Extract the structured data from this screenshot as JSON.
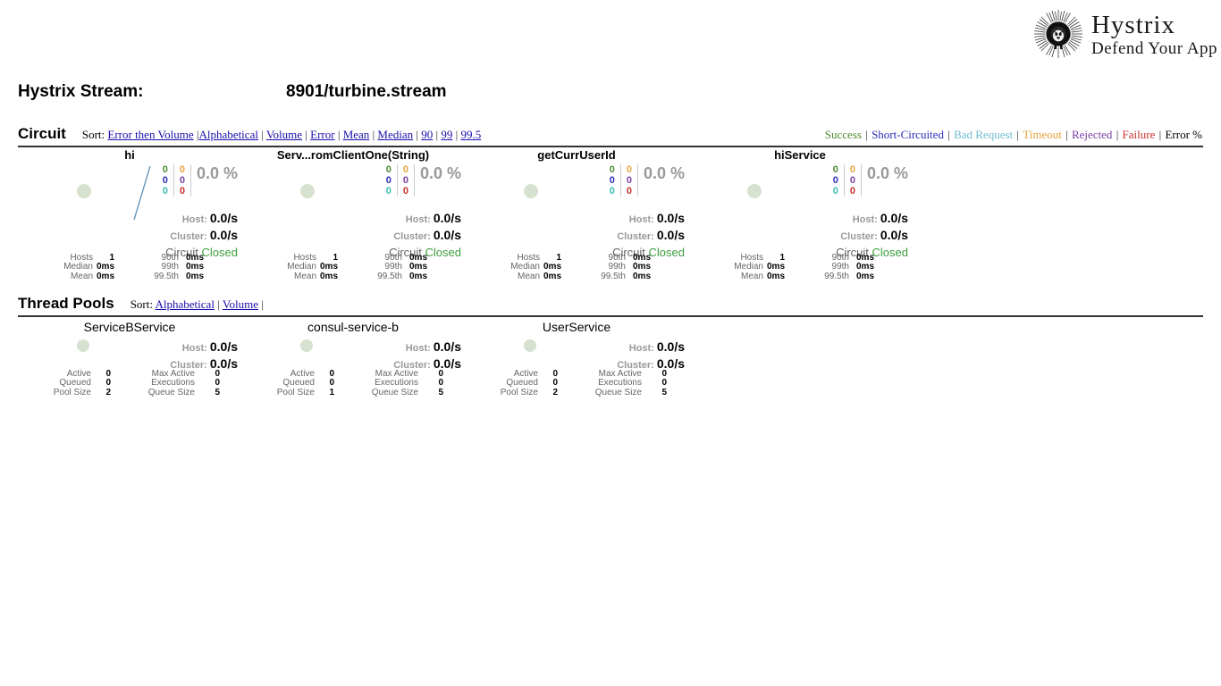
{
  "logo": {
    "title": "Hystrix",
    "subtitle": "Defend Your App",
    "mark_name": "hystrix-porcupine-logo"
  },
  "stream": {
    "label": "Hystrix Stream:",
    "value": "8901/turbine.stream"
  },
  "circuit_section": {
    "title": "Circuit",
    "sort_word": "Sort:",
    "sort_links": [
      "Error then Volume",
      "Alphabetical",
      "Volume",
      "Error",
      "Mean",
      "Median",
      "90",
      "99",
      "99.5"
    ],
    "legend": [
      {
        "label": "Success",
        "color": "#4d8b31"
      },
      {
        "label": "Short-Circuited",
        "color": "#2c2cb8"
      },
      {
        "label": "Bad Request",
        "color": "#6fbdd1"
      },
      {
        "label": "Timeout",
        "color": "#e8a33d"
      },
      {
        "label": "Rejected",
        "color": "#7a3ea3"
      },
      {
        "label": "Failure",
        "color": "#c9302c"
      },
      {
        "label": "Error %",
        "color": "#000000"
      }
    ]
  },
  "circuits": [
    {
      "name": "hi",
      "counters_left": [
        "0",
        "0",
        "0"
      ],
      "counters_right": [
        "0",
        "0",
        "0"
      ],
      "error_pct": "0.0 %",
      "host_label": "Host:",
      "host_rate": "0.0/s",
      "cluster_label": "Cluster:",
      "cluster_rate": "0.0/s",
      "circuit_label": "Circuit",
      "circuit_state": "Closed",
      "stats": [
        {
          "label": "Hosts",
          "value": "1",
          "label2": "90th",
          "value2": "0ms"
        },
        {
          "label": "Median",
          "value": "0ms",
          "label2": "99th",
          "value2": "0ms"
        },
        {
          "label": "Mean",
          "value": "0ms",
          "label2": "99.5th",
          "value2": "0ms"
        }
      ],
      "has_sparkline": true
    },
    {
      "name": "Serv...romClientOne(String)",
      "counters_left": [
        "0",
        "0",
        "0"
      ],
      "counters_right": [
        "0",
        "0",
        "0"
      ],
      "error_pct": "0.0 %",
      "host_label": "Host:",
      "host_rate": "0.0/s",
      "cluster_label": "Cluster:",
      "cluster_rate": "0.0/s",
      "circuit_label": "Circuit",
      "circuit_state": "Closed",
      "stats": [
        {
          "label": "Hosts",
          "value": "1",
          "label2": "90th",
          "value2": "0ms"
        },
        {
          "label": "Median",
          "value": "0ms",
          "label2": "99th",
          "value2": "0ms"
        },
        {
          "label": "Mean",
          "value": "0ms",
          "label2": "99.5th",
          "value2": "0ms"
        }
      ],
      "has_sparkline": false
    },
    {
      "name": "getCurrUserId",
      "counters_left": [
        "0",
        "0",
        "0"
      ],
      "counters_right": [
        "0",
        "0",
        "0"
      ],
      "error_pct": "0.0 %",
      "host_label": "Host:",
      "host_rate": "0.0/s",
      "cluster_label": "Cluster:",
      "cluster_rate": "0.0/s",
      "circuit_label": "Circuit",
      "circuit_state": "Closed",
      "stats": [
        {
          "label": "Hosts",
          "value": "1",
          "label2": "90th",
          "value2": "0ms"
        },
        {
          "label": "Median",
          "value": "0ms",
          "label2": "99th",
          "value2": "0ms"
        },
        {
          "label": "Mean",
          "value": "0ms",
          "label2": "99.5th",
          "value2": "0ms"
        }
      ],
      "has_sparkline": false
    },
    {
      "name": "hiService",
      "counters_left": [
        "0",
        "0",
        "0"
      ],
      "counters_right": [
        "0",
        "0",
        "0"
      ],
      "error_pct": "0.0 %",
      "host_label": "Host:",
      "host_rate": "0.0/s",
      "cluster_label": "Cluster:",
      "cluster_rate": "0.0/s",
      "circuit_label": "Circuit",
      "circuit_state": "Closed",
      "stats": [
        {
          "label": "Hosts",
          "value": "1",
          "label2": "90th",
          "value2": "0ms"
        },
        {
          "label": "Median",
          "value": "0ms",
          "label2": "99th",
          "value2": "0ms"
        },
        {
          "label": "Mean",
          "value": "0ms",
          "label2": "99.5th",
          "value2": "0ms"
        }
      ],
      "has_sparkline": false
    }
  ],
  "threadpool_section": {
    "title": "Thread Pools",
    "sort_word": "Sort:",
    "sort_links": [
      "Alphabetical",
      "Volume"
    ]
  },
  "threadpools": [
    {
      "name": "ServiceBService",
      "host_label": "Host:",
      "host_rate": "0.0/s",
      "cluster_label": "Cluster:",
      "cluster_rate": "0.0/s",
      "stats": [
        {
          "label": "Active",
          "value": "0",
          "label2": "Max Active",
          "value2": "0"
        },
        {
          "label": "Queued",
          "value": "0",
          "label2": "Executions",
          "value2": "0"
        },
        {
          "label": "Pool Size",
          "value": "2",
          "label2": "Queue Size",
          "value2": "5"
        }
      ]
    },
    {
      "name": "consul-service-b",
      "host_label": "Host:",
      "host_rate": "0.0/s",
      "cluster_label": "Cluster:",
      "cluster_rate": "0.0/s",
      "stats": [
        {
          "label": "Active",
          "value": "0",
          "label2": "Max Active",
          "value2": "0"
        },
        {
          "label": "Queued",
          "value": "0",
          "label2": "Executions",
          "value2": "0"
        },
        {
          "label": "Pool Size",
          "value": "1",
          "label2": "Queue Size",
          "value2": "5"
        }
      ]
    },
    {
      "name": "UserService",
      "host_label": "Host:",
      "host_rate": "0.0/s",
      "cluster_label": "Cluster:",
      "cluster_rate": "0.0/s",
      "stats": [
        {
          "label": "Active",
          "value": "0",
          "label2": "Max Active",
          "value2": "0"
        },
        {
          "label": "Queued",
          "value": "0",
          "label2": "Executions",
          "value2": "0"
        },
        {
          "label": "Pool Size",
          "value": "2",
          "label2": "Queue Size",
          "value2": "5"
        }
      ]
    }
  ],
  "colors": {
    "success": "#4d8b31",
    "short_circuited": "#2c2cb8",
    "bad_request": "#3fb9b0",
    "timeout": "#e8a33d",
    "rejected": "#7a3ea3",
    "failure": "#c9302c",
    "marker": "#cfdcc7",
    "sparkline": "#5a8fb5",
    "link": "#1a0dab",
    "closed": "#3c9e3c"
  }
}
